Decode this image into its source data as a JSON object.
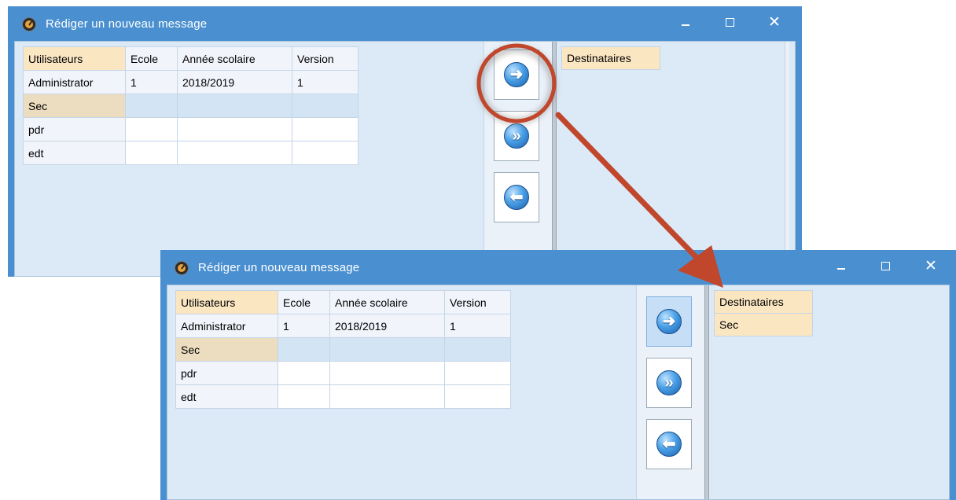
{
  "window_title": "Rédiger un nouveau message",
  "window_controls": {
    "minimize": "minimize",
    "maximize": "maximize",
    "close": "✕"
  },
  "users_table": {
    "headers": [
      "Utilisateurs",
      "Ecole",
      "Année scolaire",
      "Version"
    ],
    "rows": [
      [
        "Administrator",
        "1",
        "2018/2019",
        "1"
      ],
      [
        "Sec",
        "",
        "",
        ""
      ],
      [
        "pdr",
        "",
        "",
        ""
      ],
      [
        "edt",
        "",
        "",
        ""
      ]
    ]
  },
  "transfer_buttons": {
    "add_selected": {
      "icon": "arrow-right-icon",
      "glyph": "➜"
    },
    "add_all": {
      "icon": "double-arrow-right-icon",
      "glyph": "»"
    },
    "remove": {
      "icon": "arrow-left-icon",
      "glyph": "⬅"
    }
  },
  "before": {
    "recipients_header": "Destinataires",
    "recipients": []
  },
  "after": {
    "recipients_header": "Destinataires",
    "recipients": [
      "Sec"
    ]
  },
  "annotation": {
    "color": "#c0462c"
  }
}
